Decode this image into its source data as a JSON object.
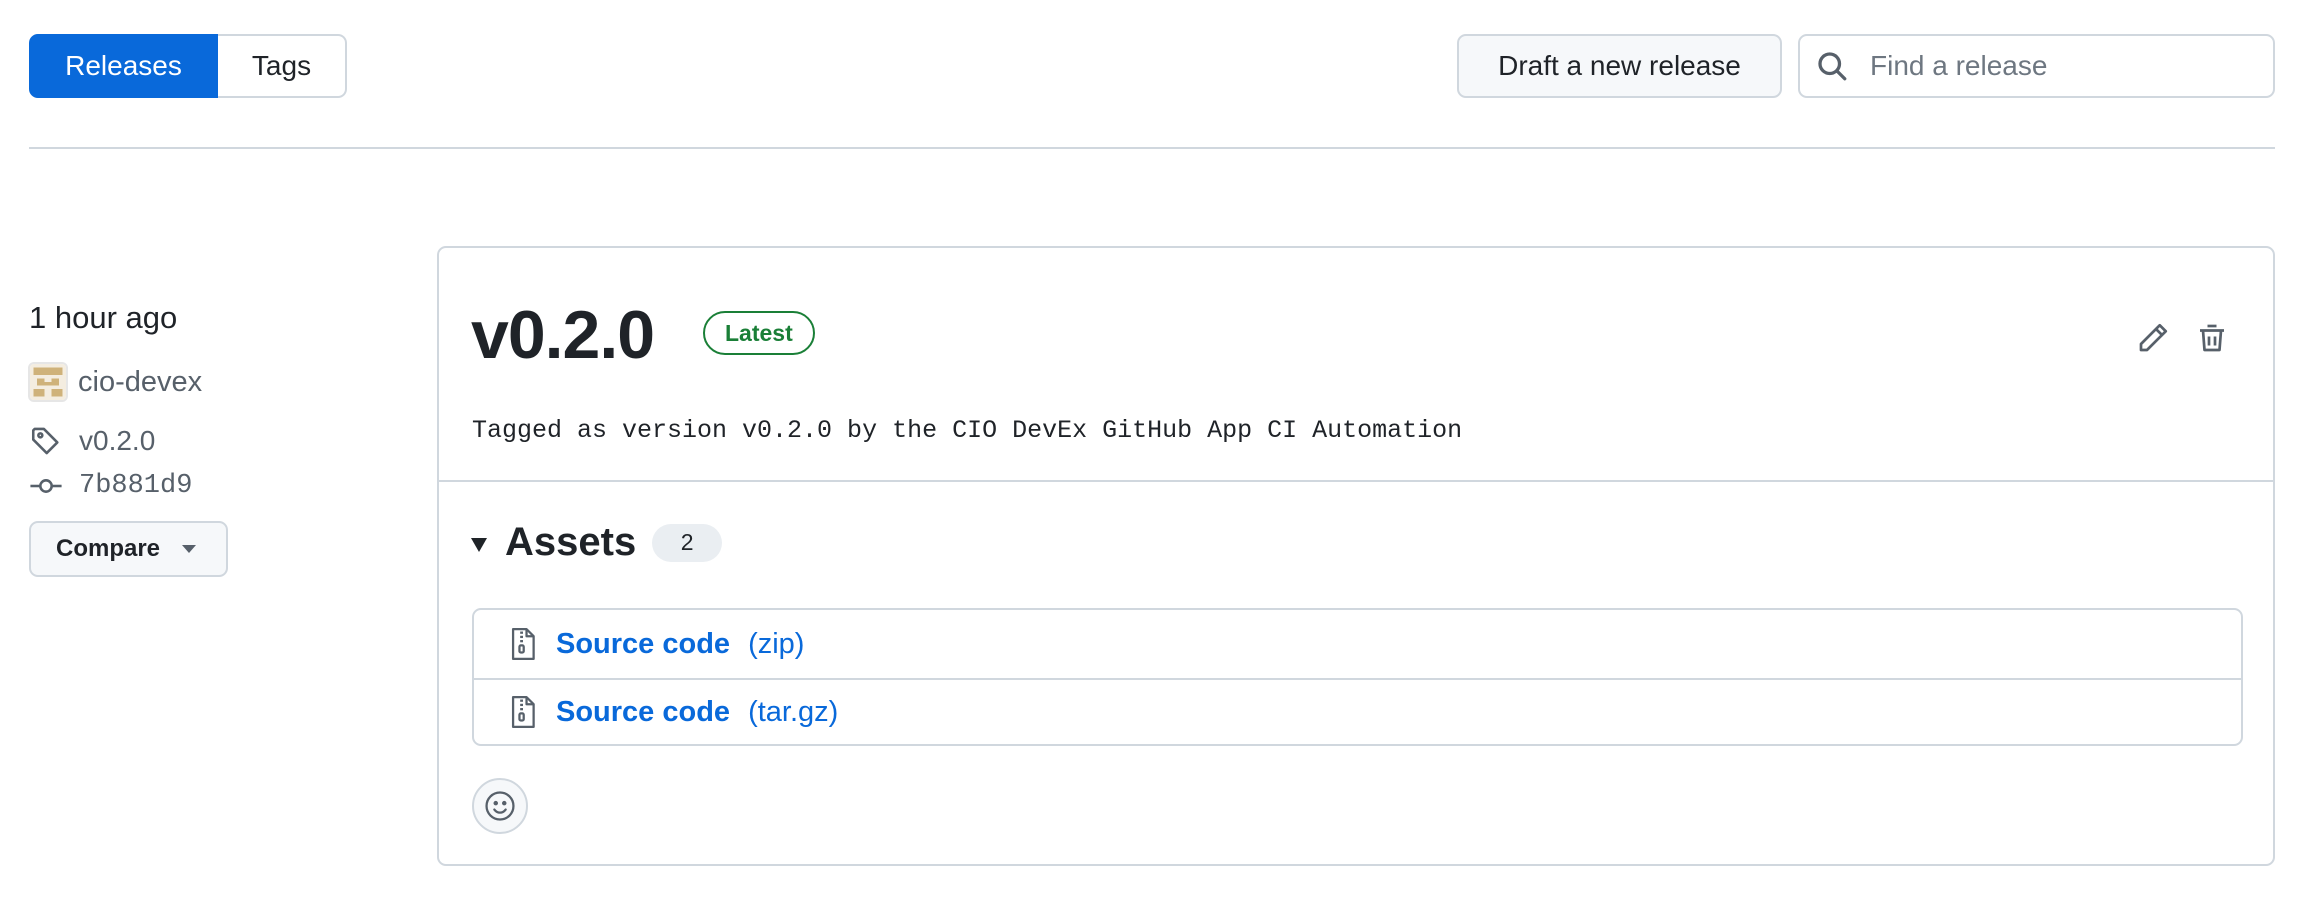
{
  "nav": {
    "tabs": [
      {
        "label": "Releases",
        "active": true
      },
      {
        "label": "Tags",
        "active": false
      }
    ],
    "draft_label": "Draft a new release",
    "search_placeholder": "Find a release"
  },
  "sidebar": {
    "time": "1 hour ago",
    "author": "cio-devex",
    "tag": "v0.2.0",
    "commit": "7b881d9",
    "compare_label": "Compare"
  },
  "release": {
    "title": "v0.2.0",
    "badge": "Latest",
    "description": "Tagged as version v0.2.0 by the CIO DevEx GitHub App CI Automation",
    "assets_heading": "Assets",
    "assets_count": "2",
    "assets": [
      {
        "name": "Source code",
        "ext": "(zip)"
      },
      {
        "name": "Source code",
        "ext": "(tar.gz)"
      }
    ]
  },
  "colors": {
    "accent": "#0969da",
    "latest_green": "#1a7f37",
    "border": "#d0d7de"
  },
  "icons": [
    "search-icon",
    "tag-icon",
    "commit-icon",
    "pencil-icon",
    "trash-icon",
    "file-zip-icon",
    "smiley-icon",
    "chevron-down-icon",
    "triangle-down-icon"
  ]
}
